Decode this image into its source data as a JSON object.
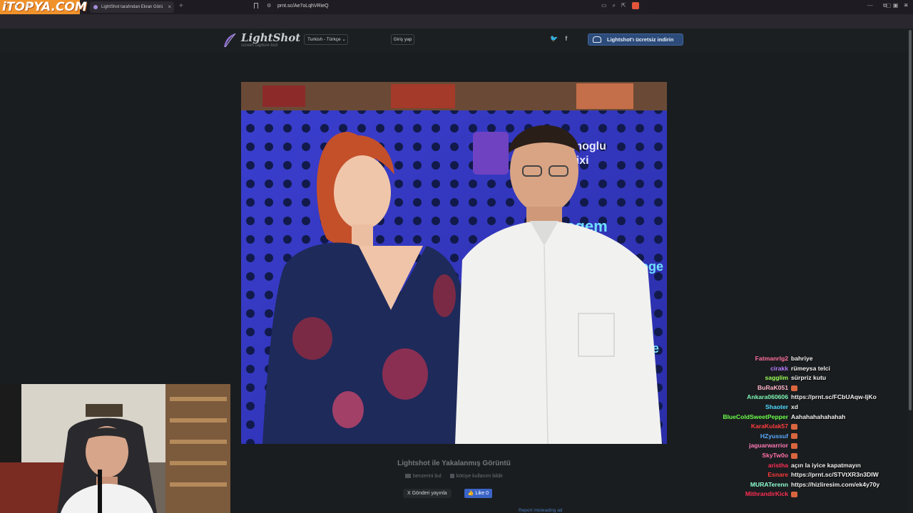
{
  "overlay_logo": "iTOPYA.COM",
  "browser": {
    "tab_title": "LightShot tarafından Ekran Görü",
    "tab_close": "×",
    "new_tab": "+",
    "url": "prnt.sc/Ae7oLqhVRieQ",
    "window_controls": [
      "—",
      "▢",
      "✕"
    ]
  },
  "lightshot": {
    "logo_title": "LightShot",
    "logo_sub": "screen capture tool",
    "language": "Turkish - Türkçe",
    "login": "Giriş yap",
    "download": "Lightshot'ı ücretsiz indirin",
    "caption_title": "Lightshot ile Yakalanmış Görüntü",
    "find_similar": "benzerini bul",
    "report_abuse": "kötüye kullanım bildir",
    "post_button": "X  Gönderi yayınla",
    "like_button": "Like 0",
    "report_ad": "Report misleading ad"
  },
  "chat": [
    {
      "user": "Fatmanrlg2",
      "color": "#ff6f9f",
      "msg": "bahriye"
    },
    {
      "user": "cirakk",
      "color": "#b57bff",
      "msg": "rümeysa telci"
    },
    {
      "user": "sagglim",
      "color": "#9cff59",
      "msg": "sürpriz kutu"
    },
    {
      "user": "BuRaK051",
      "color": "#ffb3c7",
      "msg": "",
      "emote": true
    },
    {
      "user": "Ankara060606",
      "color": "#7ef7b5",
      "msg": "https://prnt.sc/FCbUAqw-IjKo"
    },
    {
      "user": "Shaoter",
      "color": "#4ed9ff",
      "msg": "xd"
    },
    {
      "user": "BlueColdSweetPepper",
      "color": "#6cff4a",
      "msg": "Aahahahahahahah"
    },
    {
      "user": "KaraKulak57",
      "color": "#ff3d3d",
      "msg": "",
      "emote": true
    },
    {
      "user": "HZyussuf",
      "color": "#5aa9ff",
      "msg": "",
      "emote": true
    },
    {
      "user": "jaguarwarrior",
      "color": "#ff7ab8",
      "msg": "",
      "emote": true
    },
    {
      "user": "SkyTw0o",
      "color": "#ff6fa8",
      "msg": "",
      "emote": true
    },
    {
      "user": "aristha",
      "color": "#ff2d55",
      "msg": "açın la iyice kapatmayın"
    },
    {
      "user": "Esnare",
      "color": "#ff3a3a",
      "msg": "https://prnt.sc/STVtXR3n3DIW"
    },
    {
      "user": "MURATerenn",
      "color": "#8effd0",
      "msg": "https://hizliresim.com/ek4y70y"
    },
    {
      "user": "MithrandirKick",
      "color": "#ff2d55",
      "msg": "",
      "emote": true
    }
  ]
}
